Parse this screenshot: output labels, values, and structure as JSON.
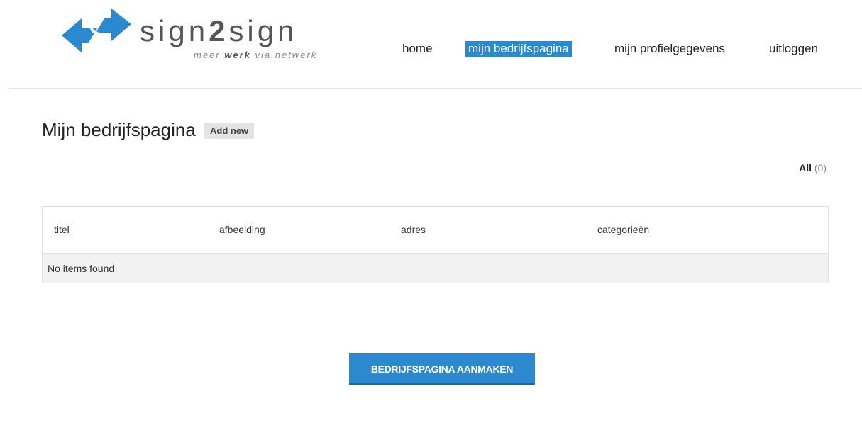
{
  "brand": {
    "name_part1": "sign",
    "name_part2": "2",
    "name_part3": "sign",
    "tagline_pre": "meer ",
    "tagline_bold": "werk",
    "tagline_post": " via netwerk",
    "logo_color": "#2a89cf"
  },
  "nav": {
    "items": [
      {
        "label": "home",
        "active": false
      },
      {
        "label": "mijn bedrijfspagina",
        "active": true
      },
      {
        "label": "mijn profielgegevens",
        "active": false
      },
      {
        "label": "uitloggen",
        "active": false
      }
    ]
  },
  "page": {
    "title": "Mijn bedrijfspagina",
    "add_new_label": "Add new",
    "filter_label": "All",
    "filter_count": "(0)"
  },
  "table": {
    "columns": [
      "titel",
      "afbeelding",
      "adres",
      "categorieën"
    ],
    "empty_message": "No items found"
  },
  "cta": {
    "label": "BEDRIJFSPAGINA AANMAKEN"
  },
  "colors": {
    "accent": "#2a89cf",
    "row_bg": "#f2f2f2"
  }
}
